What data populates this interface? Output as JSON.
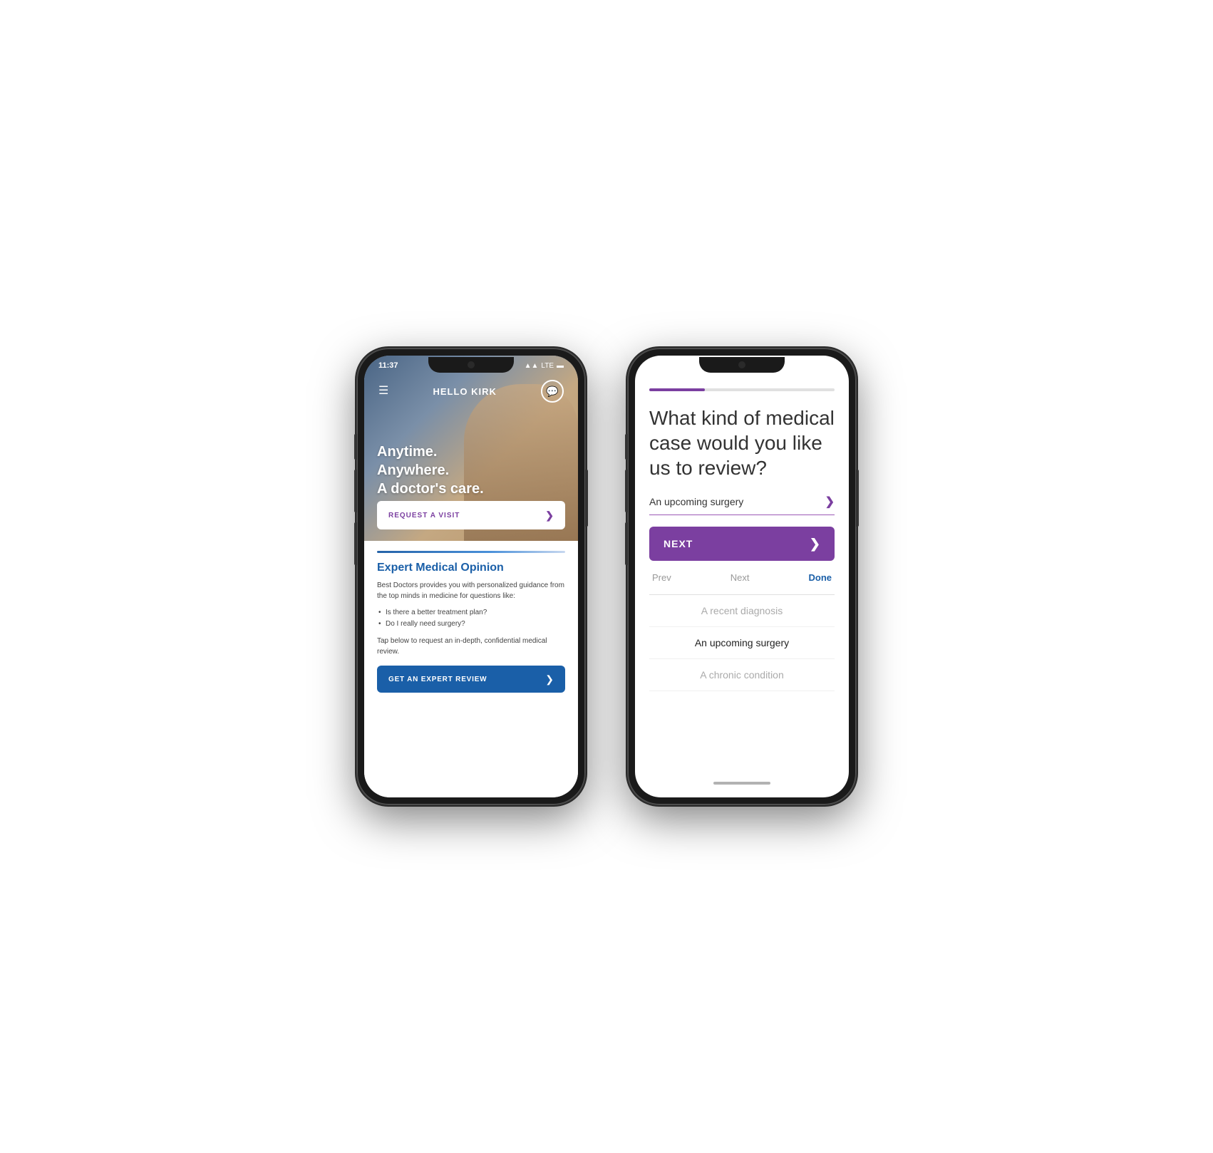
{
  "phone1": {
    "statusBar": {
      "time": "11:37",
      "icons": "▲ LTE ■"
    },
    "nav": {
      "title": "HELLO KIRK",
      "chatIcon": "💬"
    },
    "hero": {
      "text": "Anytime.\nAnywhere.\nA doctor's care.",
      "buttonLabel": "REQUEST A VISIT",
      "buttonArrow": "❯"
    },
    "content": {
      "sectionTitle": "Expert Medical Opinion",
      "description": "Best Doctors provides you with personalized guidance from the top minds in medicine for questions like:",
      "bullets": [
        "Is there a better treatment plan?",
        "Do I really need surgery?"
      ],
      "tapText": "Tap below to request an in-depth, confidential medical review.",
      "reviewButtonLabel": "GET AN EXPERT REVIEW",
      "reviewButtonArrow": "❯"
    }
  },
  "phone2": {
    "progressPercent": 30,
    "questionText": "What kind of medical case would you like us to review?",
    "dropdown": {
      "selectedValue": "An upcoming surgery",
      "chevron": "❯",
      "options": [
        {
          "label": "A recent diagnosis",
          "state": "dimmed"
        },
        {
          "label": "An upcoming surgery",
          "state": "selected"
        },
        {
          "label": "A chronic condition",
          "state": "dimmed"
        }
      ]
    },
    "nextButton": {
      "label": "NEXT",
      "arrow": "❯"
    },
    "bottomNav": {
      "prev": "Prev",
      "next": "Next",
      "done": "Done"
    }
  }
}
